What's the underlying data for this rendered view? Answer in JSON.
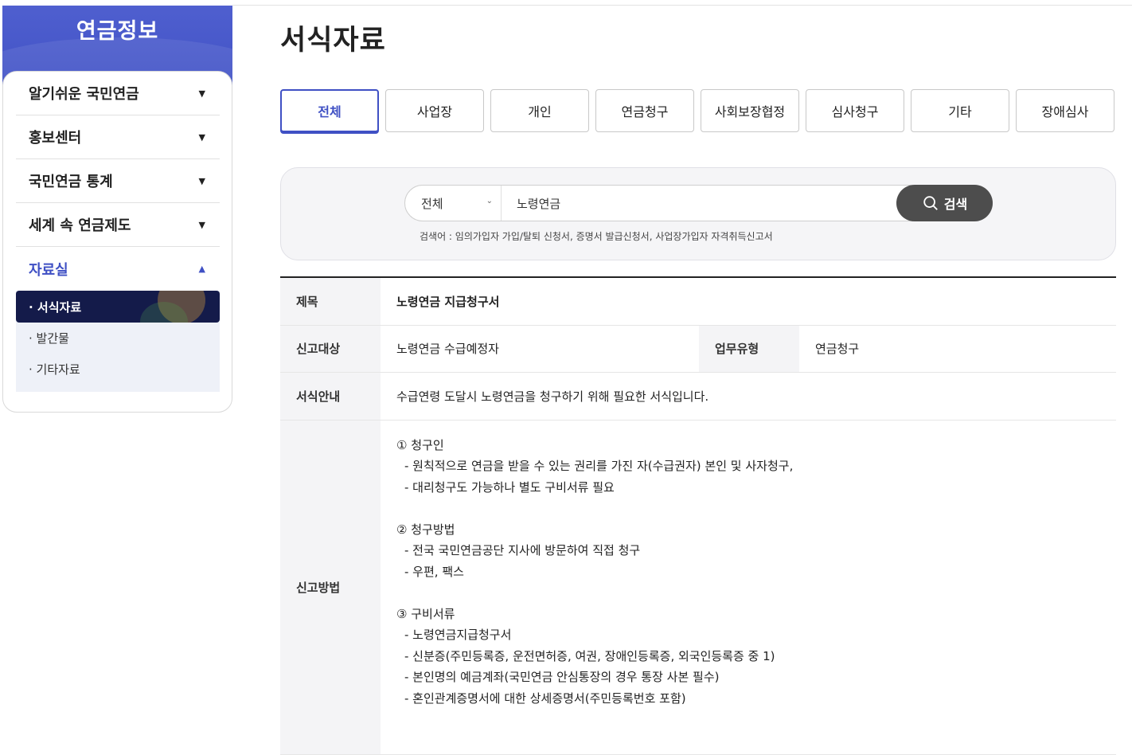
{
  "sidebar": {
    "title": "연금정보",
    "menu": [
      {
        "label": "알기쉬운 국민연금",
        "caret": "▼"
      },
      {
        "label": "홍보센터",
        "caret": "▼"
      },
      {
        "label": "국민연금 통계",
        "caret": "▼"
      },
      {
        "label": "세계 속 연금제도",
        "caret": "▼"
      },
      {
        "label": "자료실",
        "caret": "▲"
      }
    ],
    "submenu": [
      {
        "label": "· 서식자료"
      },
      {
        "label": "· 발간물"
      },
      {
        "label": "· 기타자료"
      }
    ]
  },
  "page": {
    "title": "서식자료"
  },
  "tabs": [
    "전체",
    "사업장",
    "개인",
    "연금청구",
    "사회보장협정",
    "심사청구",
    "기타",
    "장애심사"
  ],
  "active_tab": "전체",
  "search": {
    "select_value": "전체",
    "query": "노령연금",
    "button_label": "검색",
    "hint": "검색어 : 임의가입자 가입/탈퇴 신청서, 증명서 발급신청서, 사업장가입자 자격취득신고서"
  },
  "detail": {
    "title_label": "제목",
    "title_value": "노령연금 지급청구서",
    "target_label": "신고대상",
    "target_value": "노령연금 수급예정자",
    "type_label": "업무유형",
    "type_value": "연금청구",
    "guide_label": "서식안내",
    "guide_value": "수급연령 도달시 노령연금을 청구하기 위해 필요한 서식입니다.",
    "method_label": "신고방법",
    "method_lines": {
      "h1": "① 청구인",
      "l1": "- 원칙적으로 연금을 받을 수 있는 권리를 가진 자(수급권자) 본인 및 사자청구,",
      "l2": "- 대리청구도 가능하나 별도 구비서류 필요",
      "h2": "② 청구방법",
      "l3": "- 전국 국민연금공단 지사에 방문하여 직접 청구",
      "l4": "- 우편, 팩스",
      "h3": "③ 구비서류",
      "l5": "- 노령연금지급청구서",
      "l6": "- 신분증(주민등록증, 운전면허증, 여권, 장애인등록증, 외국인등록증 중 1)",
      "l7": "- 본인명의 예금계좌(국민연금 안심통장의 경우 통장 사본 필수)",
      "l8": "- 혼인관계증명서에 대한 상세증명서(주민등록번호 포함)"
    }
  },
  "colors": {
    "brand": "#3f50c4",
    "active_sub": "#141b4a",
    "search_button": "#4d4d4d"
  }
}
